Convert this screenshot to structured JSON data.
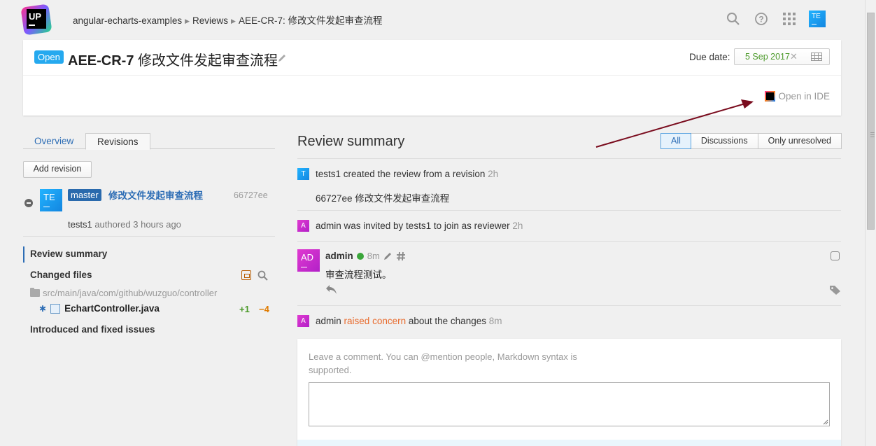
{
  "header": {
    "logo_text": "UP",
    "breadcrumbs": [
      "angular-echarts-examples",
      "Reviews",
      "AEE-CR-7: 修改文件发起审查流程"
    ],
    "user_initials": "TE"
  },
  "review": {
    "status": "Open",
    "id": "AEE-CR-7",
    "title": "修改文件发起审查流程",
    "due_label": "Due date:",
    "due_value": "5 Sep 2017",
    "open_in_ide": "Open in IDE"
  },
  "left": {
    "tabs": [
      "Overview",
      "Revisions"
    ],
    "active_tab": "Revisions",
    "add_revision": "Add revision",
    "revision": {
      "avatar": "TE",
      "branch": "master",
      "message": "修改文件发起审查流程",
      "hash": "66727ee",
      "author": "tests1",
      "authored_text": "authored 3 hours ago"
    },
    "nav": {
      "review_summary": "Review summary",
      "changed_files": "Changed files",
      "folder": "src/main/java/com/github/wuzguo/controller",
      "file": "EchartController.java",
      "added": "+1",
      "removed": "−4",
      "issues": "Introduced and fixed issues"
    }
  },
  "summary": {
    "title": "Review summary",
    "filters": [
      "All",
      "Discussions",
      "Only unresolved"
    ],
    "active_filter": "All",
    "events": [
      {
        "avatar": "T",
        "text": "tests1 created the review from a revision",
        "time": "2h"
      },
      {
        "text": "66727ee 修改文件发起审查流程"
      },
      {
        "avatar": "A",
        "text": "admin was invited by tests1 to join as reviewer",
        "time": "2h"
      }
    ],
    "comment": {
      "avatar": "AD",
      "author": "admin",
      "time": "8m",
      "body": "审查流程测试。"
    },
    "concern": {
      "avatar": "A",
      "author": "admin",
      "action": "raised concern",
      "rest": "about the changes",
      "time": "8m"
    },
    "comment_placeholder": "Leave a comment. You can @mention people, Markdown syntax is supported."
  },
  "colors": {
    "accent": "#2d6db5",
    "open_badge": "#25a9ef",
    "due": "#4c9a2a",
    "concern": "#e86a2c",
    "arrow": "#7a0c1e"
  },
  "icons": [
    "search-icon",
    "help-icon",
    "apps-grid-icon",
    "pencil-icon",
    "calendar-icon",
    "jetbrains-ide-icon",
    "collapse-icon",
    "filter-icon",
    "magnifier-icon",
    "folder-icon",
    "file-icon",
    "edit-icon",
    "hash-icon",
    "reply-icon",
    "reaction-icon",
    "tag-icon"
  ]
}
